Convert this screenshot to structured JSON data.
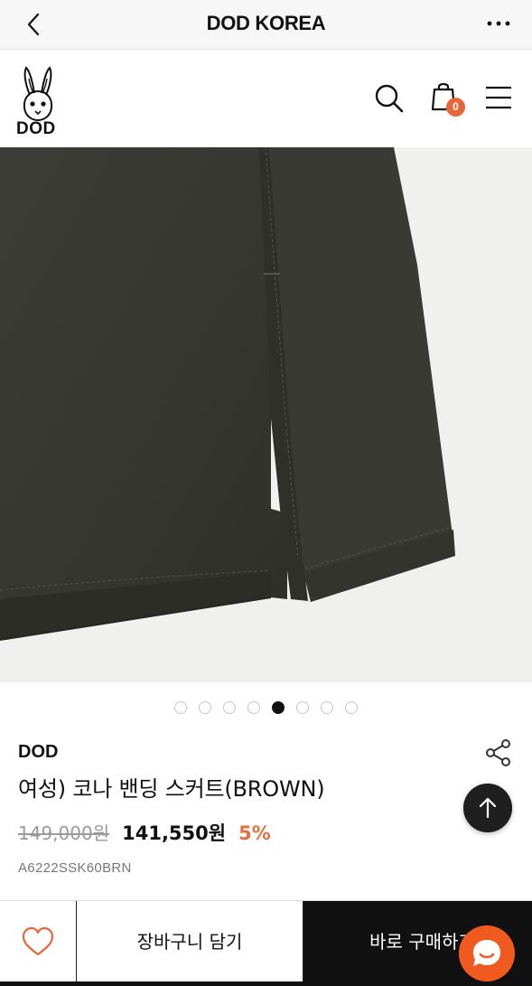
{
  "topbar": {
    "title": "DOD KOREA",
    "back_icon": "chevron-left-icon",
    "more_icon": "more-horizontal-icon"
  },
  "header": {
    "logo_text": "DOD",
    "cart_count": "0",
    "search_icon": "search-icon",
    "bag_icon": "shopping-bag-icon",
    "menu_icon": "hamburger-menu-icon"
  },
  "gallery": {
    "total_slides": 8,
    "active_index": 4,
    "image_desc_color": "#3a3b34"
  },
  "product": {
    "brand": "DOD",
    "name": "여성) 코나 밴딩 스커트(BROWN)",
    "original_price": "149,000원",
    "sale_price": "141,550원",
    "discount": "5%",
    "sku": "A6222SSK60BRN"
  },
  "actions": {
    "cart_label": "장바구니 담기",
    "buy_label": "바로 구매하기"
  },
  "colors": {
    "accent": "#e8673a",
    "discount": "#e3703f",
    "chat": "#f05a1f"
  }
}
